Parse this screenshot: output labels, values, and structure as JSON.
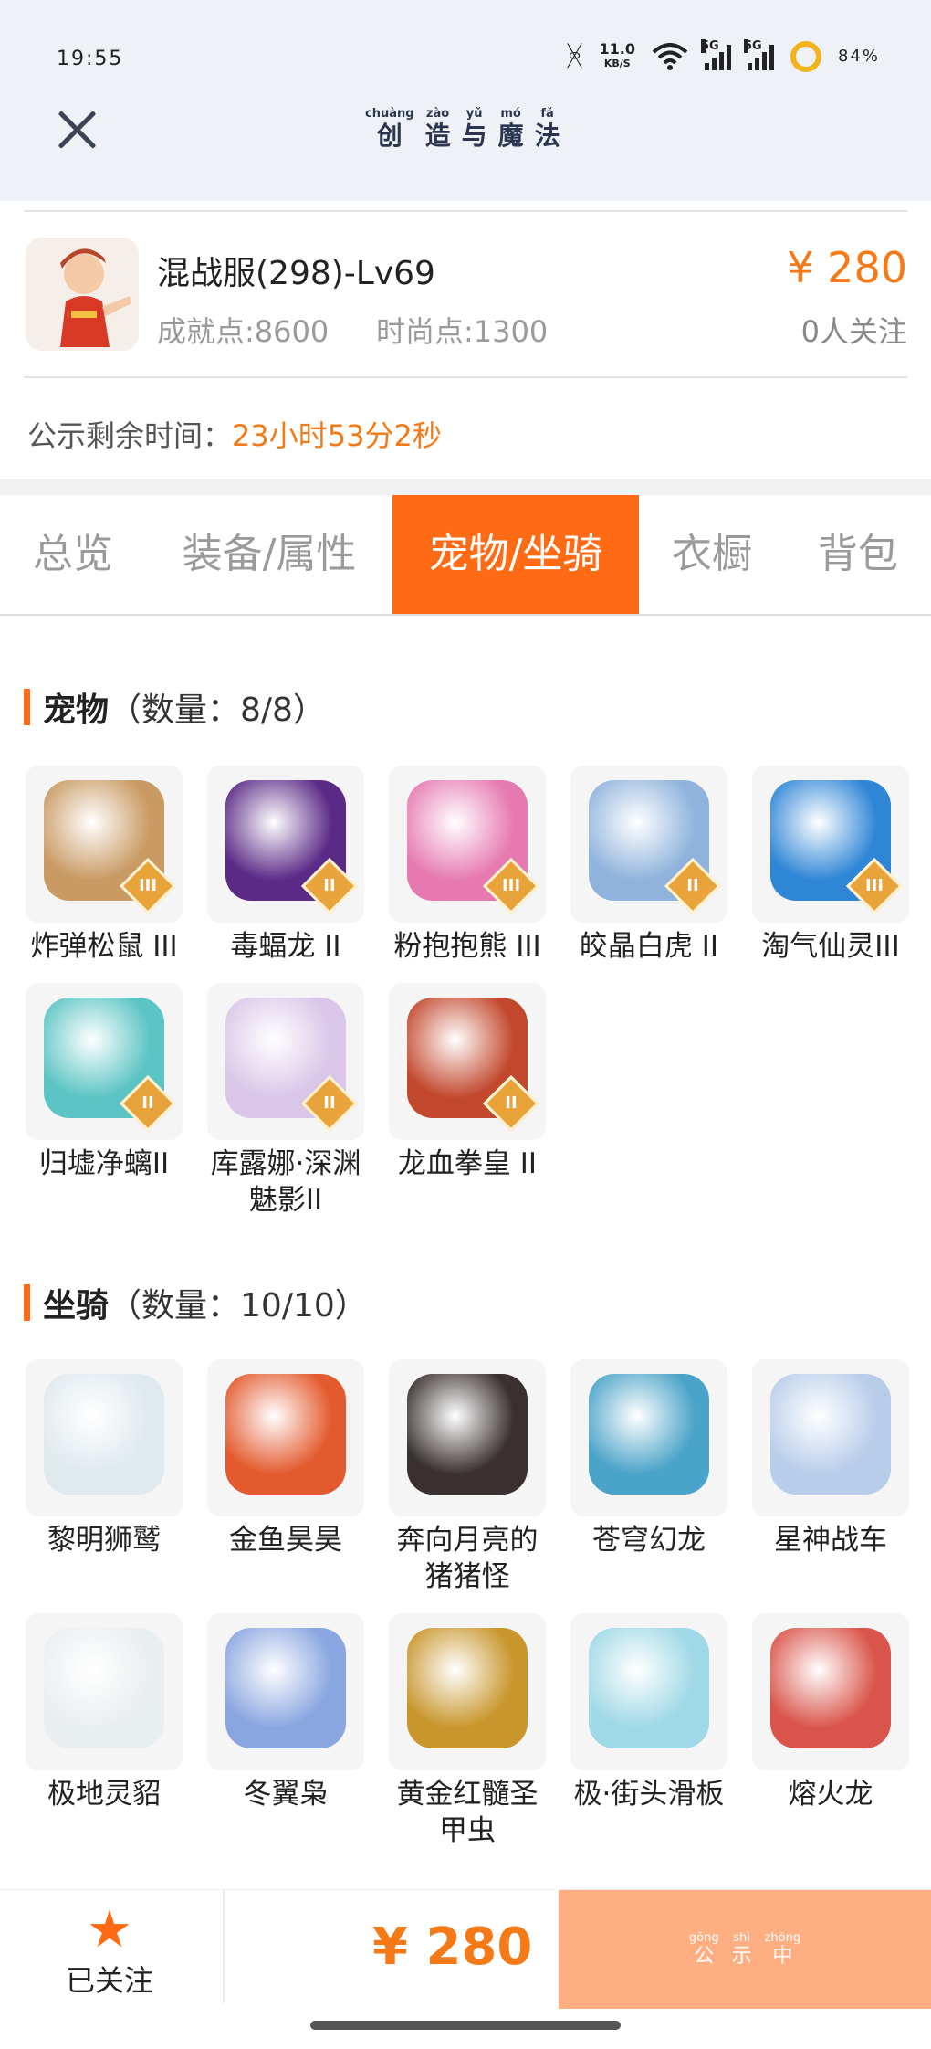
{
  "status_bar": {
    "time": "19:55",
    "net_speed": "11.0",
    "net_unit": "KB/S",
    "sig1": "5G",
    "sig2": "5G",
    "battery": "84%"
  },
  "header": {
    "close_icon": "close-icon",
    "brand": [
      {
        "py": "chuàng",
        "hz": "创"
      },
      {
        "py": "zào",
        "hz": "造"
      },
      {
        "py": "yǔ",
        "hz": "与"
      },
      {
        "py": "mó",
        "hz": "魔"
      },
      {
        "py": "fǎ",
        "hz": "法"
      }
    ]
  },
  "listing": {
    "title": "混战服(298)-Lv69",
    "price": "¥ 280",
    "achievement": "成就点:8600",
    "fashion": "时尚点:1300",
    "followers": "0人关注",
    "countdown_label": "公示剩余时间：",
    "countdown_value": "23小时53分2秒"
  },
  "tabs": [
    "总览",
    "装备/属性",
    "宠物/坐骑",
    "衣橱",
    "背包"
  ],
  "active_tab": 2,
  "pets": {
    "title": "宠物",
    "count": "（数量：8/8）",
    "items": [
      {
        "name": "炸弹松鼠 III",
        "badge": "III",
        "color": "#c99a63"
      },
      {
        "name": "毒蝠龙 II",
        "badge": "II",
        "color": "#5b2a86"
      },
      {
        "name": "粉抱抱熊 III",
        "badge": "III",
        "color": "#e67ab0"
      },
      {
        "name": "皎晶白虎 II",
        "badge": "II",
        "color": "#8fb3dc"
      },
      {
        "name": "淘气仙灵III",
        "badge": "III",
        "color": "#2f86d6"
      },
      {
        "name": "归墟净螭II",
        "badge": "II",
        "color": "#5cc4c4"
      },
      {
        "name": "库露娜·深渊魅影II",
        "badge": "II",
        "color": "#d9c6e8"
      },
      {
        "name": "龙血拳皇 II",
        "badge": "II",
        "color": "#c2482d"
      }
    ]
  },
  "mounts": {
    "title": "坐骑",
    "count": "（数量：10/10）",
    "items": [
      {
        "name": "黎明狮鹫",
        "color": "#dfe9ee"
      },
      {
        "name": "金鱼昊昊",
        "color": "#e35a2e"
      },
      {
        "name": "奔向月亮的猪猪怪",
        "color": "#3a3030"
      },
      {
        "name": "苍穹幻龙",
        "color": "#4aa3c8"
      },
      {
        "name": "星神战车",
        "color": "#b8cdea"
      },
      {
        "name": "极地灵貂",
        "color": "#e9eef0"
      },
      {
        "name": "冬翼枭",
        "color": "#8aa6e0"
      },
      {
        "name": "黄金红髓圣甲虫",
        "color": "#c8962c"
      },
      {
        "name": "极·街头滑板",
        "color": "#9fd8e6"
      },
      {
        "name": "熔火龙",
        "color": "#d9544a"
      }
    ]
  },
  "bottom_bar": {
    "followed_label": "已关注",
    "price": "¥ 280",
    "status": [
      {
        "py": "gōng",
        "hz": "公"
      },
      {
        "py": "shì",
        "hz": "示"
      },
      {
        "py": "zhōng",
        "hz": "中"
      }
    ]
  }
}
